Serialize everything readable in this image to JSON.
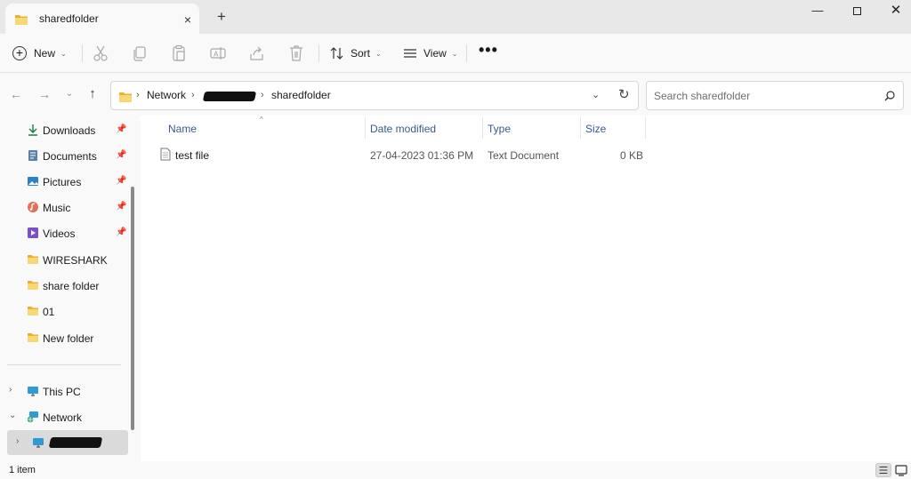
{
  "window": {
    "tab_title": "sharedfolder",
    "tab_close_icon": "×",
    "new_tab_icon": "+",
    "minimize_icon": "—",
    "close_icon": "✕"
  },
  "toolbar": {
    "new_label": "New",
    "sort_label": "Sort",
    "view_label": "View",
    "more_label": "•••",
    "icons": [
      "cut-icon",
      "copy-icon",
      "paste-icon",
      "rename-icon",
      "share-icon",
      "delete-icon"
    ]
  },
  "address": {
    "crumbs": [
      "Network",
      "sharedfolder"
    ],
    "redacted_crumb": "[redacted]"
  },
  "search": {
    "placeholder": "Search sharedfolder"
  },
  "sidebar": {
    "quick_access": [
      {
        "label": "Downloads",
        "icon": "download-icon",
        "pinned": true
      },
      {
        "label": "Documents",
        "icon": "documents-icon",
        "pinned": true
      },
      {
        "label": "Pictures",
        "icon": "pictures-icon",
        "pinned": true
      },
      {
        "label": "Music",
        "icon": "music-icon",
        "pinned": true
      },
      {
        "label": "Videos",
        "icon": "videos-icon",
        "pinned": true
      },
      {
        "label": "WIRESHARK",
        "icon": "folder-icon",
        "pinned": false
      },
      {
        "label": "share folder",
        "icon": "folder-icon",
        "pinned": false
      },
      {
        "label": "01",
        "icon": "folder-icon",
        "pinned": false
      },
      {
        "label": "New folder",
        "icon": "folder-icon",
        "pinned": false
      }
    ],
    "this_pc": "This PC",
    "network": "Network",
    "network_child": "[redacted]"
  },
  "columns": {
    "name": "Name",
    "date": "Date modified",
    "type": "Type",
    "size": "Size"
  },
  "files": [
    {
      "name": "test file",
      "date": "27-04-2023 01:36 PM",
      "type": "Text Document",
      "size": "0 KB",
      "icon": "text-file-icon"
    }
  ],
  "status": {
    "item_count": "1 item"
  },
  "colors": {
    "folder_yellow": "#f2c744",
    "accent_blue": "#0067c0",
    "header_text": "#3a5a8a"
  }
}
